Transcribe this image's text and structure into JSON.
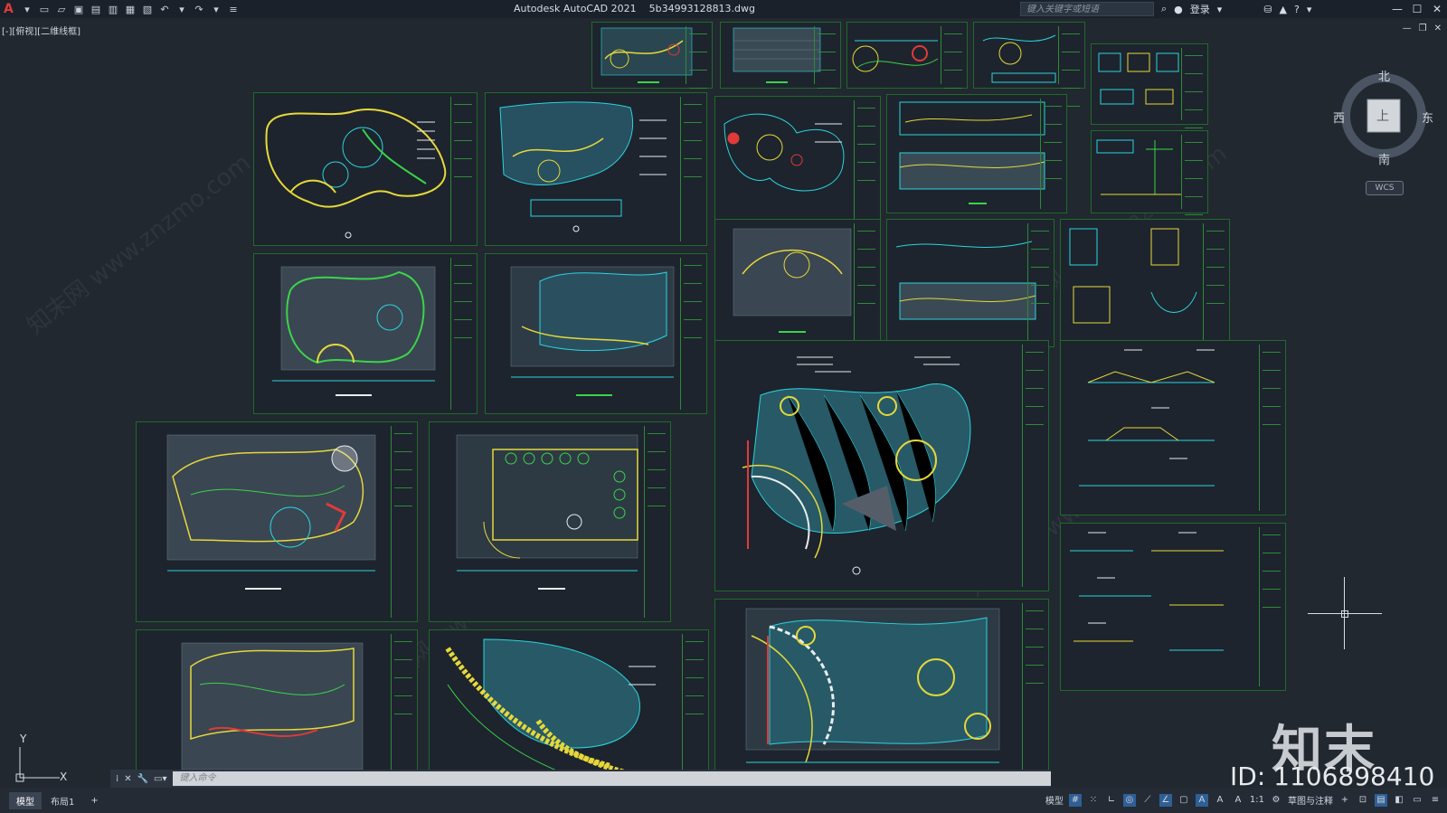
{
  "app": {
    "title": "Autodesk AutoCAD 2021",
    "filename": "5b34993128813.dwg",
    "search_placeholder": "键入关键字或短语",
    "login_label": "登录"
  },
  "viewport": {
    "view_label": "[-][俯视][二维线框]",
    "viewcube": {
      "north": "北",
      "south": "南",
      "east": "东",
      "west": "西",
      "face": "上"
    },
    "wcs_label": "WCS",
    "ucs_x": "X",
    "ucs_y": "Y"
  },
  "commandline": {
    "placeholder": "键入命令"
  },
  "statusbar": {
    "tabs": [
      {
        "label": "模型",
        "active": true
      },
      {
        "label": "布局1",
        "active": false
      }
    ],
    "add_tab": "+",
    "model_label": "模型",
    "scale_label": "1:1",
    "workspace_label": "草图与注释"
  },
  "watermark": {
    "logo_text": "知末",
    "id_text": "ID: 1106898410",
    "diagonal_text": "知末网 www.znzmo.com"
  },
  "colors": {
    "sheet_border": "#1f6a2a",
    "cyan": "#2ad4e0",
    "yellow": "#e6d83a",
    "green": "#3ad44a",
    "red": "#e03a3a",
    "white": "#e8ecef"
  }
}
